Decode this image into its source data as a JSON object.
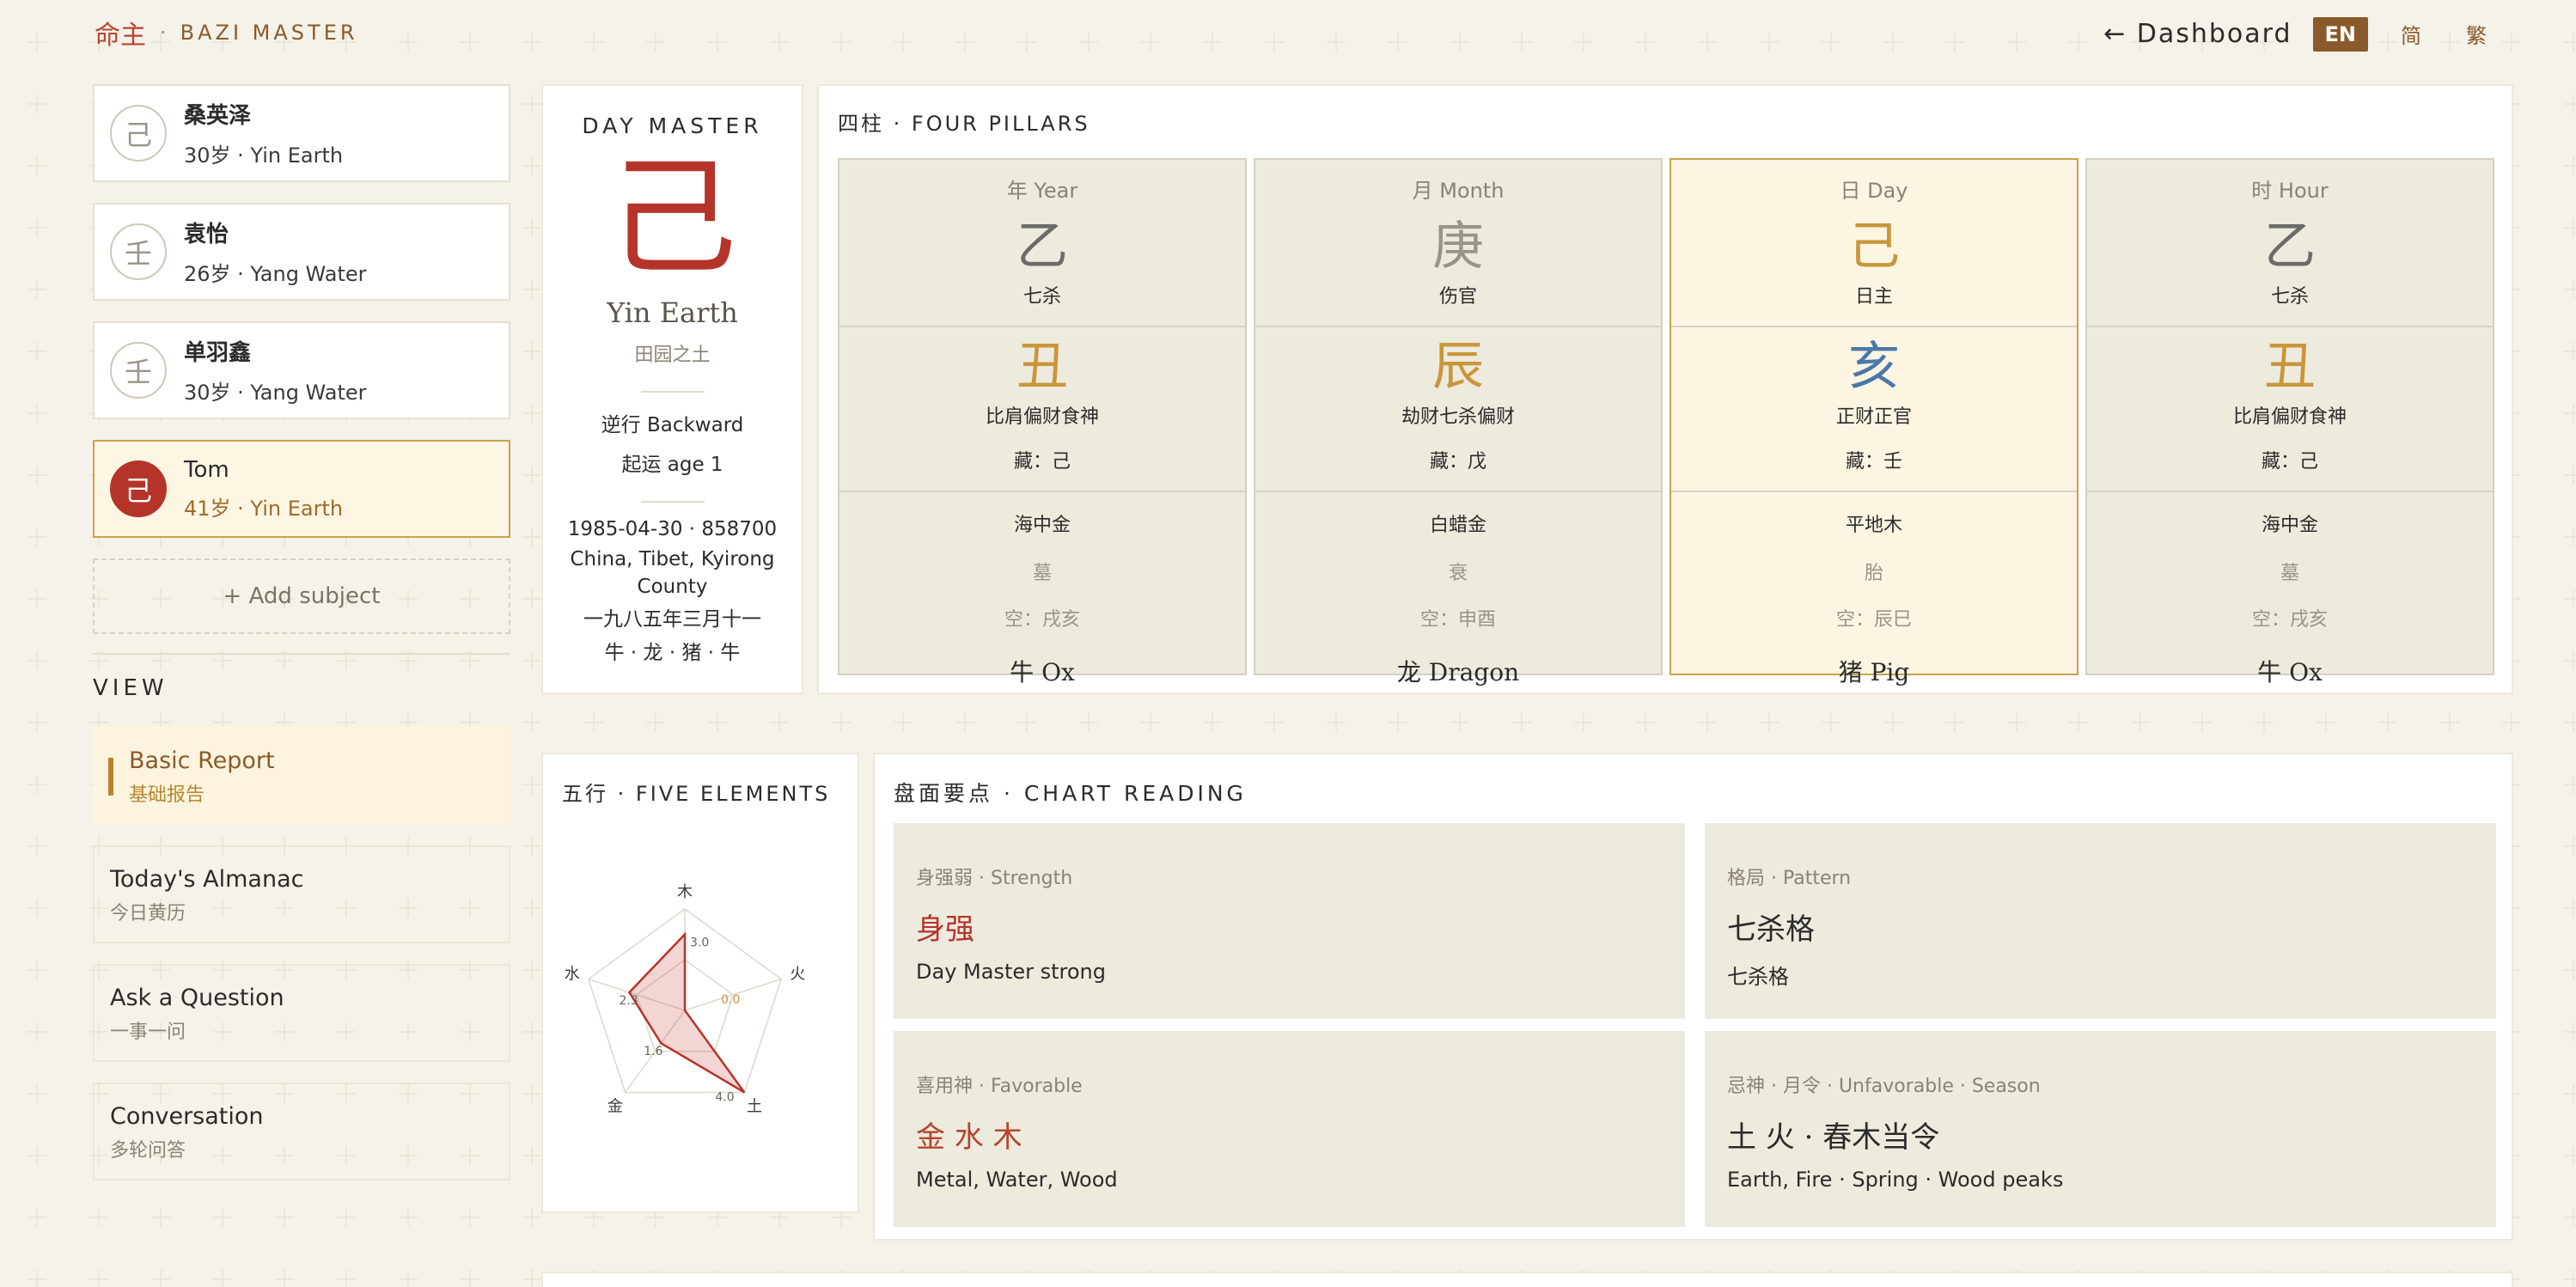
{
  "header": {
    "brand_cn": "命主",
    "brand_en": "BAZI MASTER",
    "dashboard_link": "← Dashboard",
    "lang_options": [
      "EN",
      "简",
      "繁"
    ],
    "active_lang": "EN"
  },
  "sidebar": {
    "subjects": [
      {
        "avatar": "己",
        "name": "桑英泽",
        "meta": "30岁 · Yin Earth"
      },
      {
        "avatar": "壬",
        "name": "袁怡",
        "meta": "26岁 · Yang Water"
      },
      {
        "avatar": "壬",
        "name": "单羽鑫",
        "meta": "30岁 · Yang Water"
      },
      {
        "avatar": "己",
        "name": "Tom",
        "meta": "41岁 · Yin Earth"
      }
    ],
    "add_subject": "+ Add subject",
    "view_label": "VIEW",
    "views": [
      {
        "title": "Basic Report",
        "sub": "基础报告"
      },
      {
        "title": "Today's Almanac",
        "sub": "今日黄历"
      },
      {
        "title": "Ask a Question",
        "sub": "一事一问"
      },
      {
        "title": "Conversation",
        "sub": "多轮问答"
      }
    ]
  },
  "day_master": {
    "label": "DAY MASTER",
    "char": "己",
    "name": "Yin Earth",
    "desc": "田园之土",
    "direction": "逆行 Backward",
    "start_age": "起运 age 1",
    "birth": "1985-04-30 · 858700",
    "place": "China, Tibet, Kyirong County",
    "lunar": "一九八五年三月十一",
    "zodiacs": "牛 · 龙 · 猪 · 牛"
  },
  "four_pillars": {
    "title": "四柱 · FOUR PILLARS",
    "pillars": [
      {
        "head": "年 Year",
        "stem": "乙",
        "stem_color": "#6b6b6b",
        "stem_god": "七杀",
        "branch": "丑",
        "branch_color": "#c9963a",
        "branch_gods": "比肩偏财食神",
        "hidden": "藏：己",
        "nayin": "海中金",
        "stage": "墓",
        "void": "空：戌亥",
        "animal": "牛 Ox"
      },
      {
        "head": "月 Month",
        "stem": "庚",
        "stem_color": "#9a9488",
        "stem_god": "伤官",
        "branch": "辰",
        "branch_color": "#c9963a",
        "branch_gods": "劫财七杀偏财",
        "hidden": "藏：戊",
        "nayin": "白蜡金",
        "stage": "衰",
        "void": "空：申酉",
        "animal": "龙 Dragon"
      },
      {
        "head": "日 Day",
        "stem": "己",
        "stem_color": "#c9963a",
        "stem_god": "日主",
        "branch": "亥",
        "branch_color": "#4a78a8",
        "branch_gods": "正财正官",
        "hidden": "藏：壬",
        "nayin": "平地木",
        "stage": "胎",
        "void": "空：辰巳",
        "animal": "猪 Pig"
      },
      {
        "head": "时 Hour",
        "stem": "乙",
        "stem_color": "#6b6b6b",
        "stem_god": "七杀",
        "branch": "丑",
        "branch_color": "#c9963a",
        "branch_gods": "比肩偏财食神",
        "hidden": "藏：己",
        "nayin": "海中金",
        "stage": "墓",
        "void": "空：戌亥",
        "animal": "牛 Ox"
      }
    ]
  },
  "five_elements": {
    "title": "五行 · FIVE ELEMENTS",
    "axes": [
      "木",
      "火",
      "土",
      "金",
      "水"
    ],
    "values": [
      3.0,
      0.0,
      4.0,
      1.6,
      2.3
    ],
    "value_labels": [
      "3.0",
      "0.0",
      "4.0",
      "1.6",
      "2.3"
    ],
    "max": 4.0
  },
  "chart_reading": {
    "title": "盘面要点 · CHART READING",
    "items": [
      {
        "label": "身强弱 · Strength",
        "value": "身强",
        "value_color": "#b5342a",
        "desc": "Day Master strong"
      },
      {
        "label": "格局 · Pattern",
        "value": "七杀格",
        "value_color": "#2b2b2b",
        "desc": "七杀格"
      },
      {
        "label": "喜用神 · Favorable",
        "value": "金 水 木",
        "value_color": "#b5452f",
        "desc": "Metal, Water, Wood"
      },
      {
        "label": "忌神 · 月令 · Unfavorable · Season",
        "value": "土 火 · 春木当令",
        "value_color": "#2b2b2b",
        "desc": "Earth, Fire · Spring · Wood peaks"
      }
    ]
  }
}
